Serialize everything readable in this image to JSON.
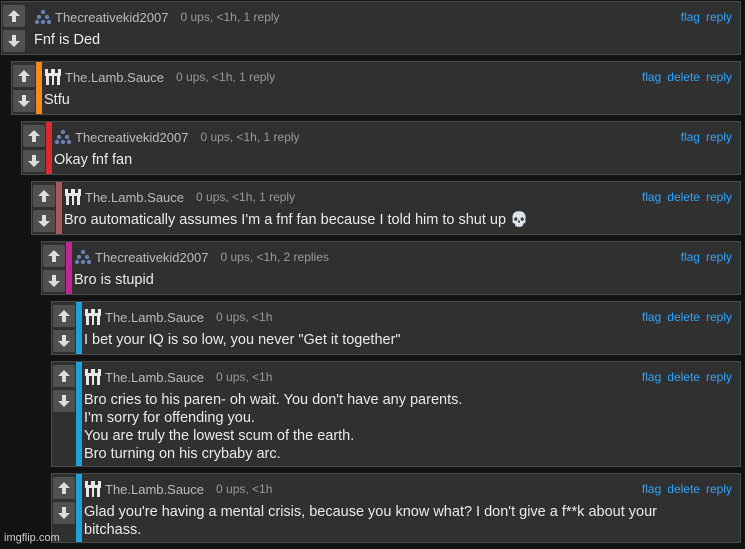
{
  "colors": {
    "accent_orange": "#f08c1e",
    "accent_red": "#d92b2b",
    "accent_rose": "#a85a5a",
    "accent_magenta": "#c0259a",
    "accent_blue": "#1aa3d8",
    "link": "#2aa6ff"
  },
  "comments": [
    {
      "user": "Thecreativekid2007",
      "meta": "0 ups, <1h, 1 reply",
      "actions": [
        "flag",
        "reply"
      ],
      "lines": [
        "Fnf is Ded"
      ],
      "avatar": "triangle-dots-icon"
    },
    {
      "user": "The.Lamb.Sauce",
      "meta": "0 ups, <1h, 1 reply",
      "actions": [
        "flag",
        "delete",
        "reply"
      ],
      "lines": [
        "Stfu"
      ],
      "avatar": "pixel-castle-icon"
    },
    {
      "user": "Thecreativekid2007",
      "meta": "0 ups, <1h, 1 reply",
      "actions": [
        "flag",
        "reply"
      ],
      "lines": [
        "Okay fnf fan"
      ],
      "avatar": "triangle-dots-icon"
    },
    {
      "user": "The.Lamb.Sauce",
      "meta": "0 ups, <1h, 1 reply",
      "actions": [
        "flag",
        "delete",
        "reply"
      ],
      "lines": [
        "Bro automatically assumes I'm a fnf fan because I told him to shut up 💀"
      ],
      "avatar": "pixel-castle-icon"
    },
    {
      "user": "Thecreativekid2007",
      "meta": "0 ups, <1h, 2 replies",
      "actions": [
        "flag",
        "reply"
      ],
      "lines": [
        "Bro is stupid"
      ],
      "avatar": "triangle-dots-icon"
    },
    {
      "user": "The.Lamb.Sauce",
      "meta": "0 ups, <1h",
      "actions": [
        "flag",
        "delete",
        "reply"
      ],
      "lines": [
        "I bet your IQ is so low, you never \"Get it together\""
      ],
      "avatar": "pixel-castle-icon"
    },
    {
      "user": "The.Lamb.Sauce",
      "meta": "0 ups, <1h",
      "actions": [
        "flag",
        "delete",
        "reply"
      ],
      "lines": [
        "Bro cries to his paren- oh wait. You don't have any parents.",
        "I'm sorry for offending you.",
        "You are truly the lowest scum of the earth.",
        "Bro turning on his crybaby arc."
      ],
      "avatar": "pixel-castle-icon"
    },
    {
      "user": "The.Lamb.Sauce",
      "meta": "0 ups, <1h",
      "actions": [
        "flag",
        "delete",
        "reply"
      ],
      "lines": [
        "Glad you're having a mental crisis, because you know what? I don't give a f**k about your",
        "bitchass."
      ],
      "avatar": "pixel-castle-icon"
    }
  ],
  "watermark": "imgflip.com"
}
